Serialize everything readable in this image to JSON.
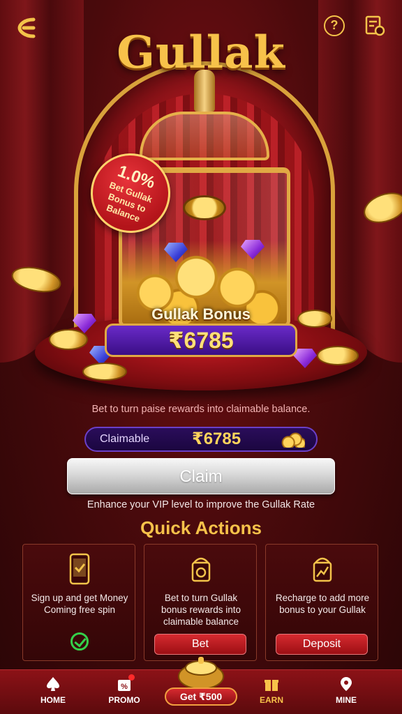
{
  "header": {
    "title": "Gullak"
  },
  "tag": {
    "rate": "1.0%",
    "text_line1": "Bet Gullak",
    "text_line2": "Bonus to",
    "text_line3": "Balance"
  },
  "bonus": {
    "label": "Gullak Bonus",
    "amount": "₹6785"
  },
  "hint": "Bet to turn paise rewards into claimable balance.",
  "claimable": {
    "label": "Claimable",
    "amount": "₹6785"
  },
  "claim_button": "Claim",
  "vip_text": "Enhance your VIP level to improve the Gullak Rate",
  "quick_actions": {
    "title": "Quick Actions",
    "cards": [
      {
        "text": "Sign up and get Money Coming free spin",
        "status": "completed"
      },
      {
        "text": "Bet to turn Gullak bonus rewards into claimable balance",
        "button": "Bet"
      },
      {
        "text": "Recharge to add more bonus to your Gullak",
        "button": "Deposit"
      }
    ]
  },
  "bottom_nav": {
    "home": "HOME",
    "promo": "PROMO",
    "get": "Get ₹500",
    "earn": "EARN",
    "mine": "MINE"
  },
  "colors": {
    "accent_gold": "#f7c24a",
    "nav_red": "#8c1217",
    "purple_box": "#3a0e86"
  }
}
